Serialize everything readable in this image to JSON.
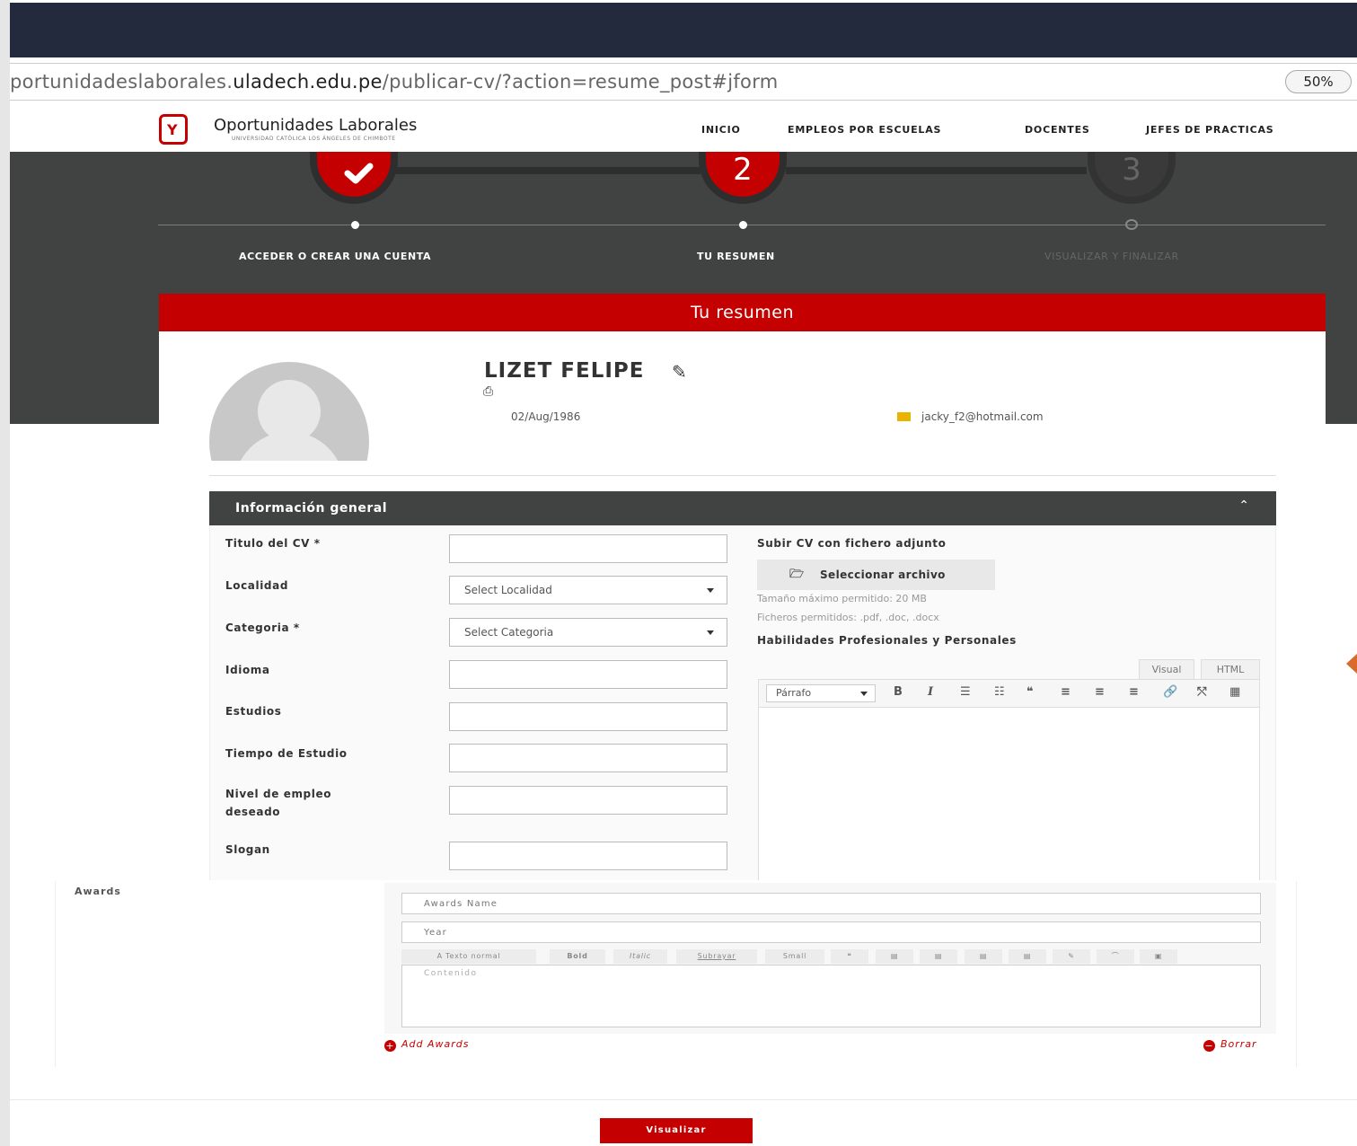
{
  "browser": {
    "url_prefix": "portunidadeslaborales.",
    "url_domain": "uladech.edu.pe",
    "url_path": "/publicar-cv/?action=resume_post#jform",
    "zoom": "50%"
  },
  "nav": {
    "logo_title": "Oportunidades Laborales",
    "logo_sub": "UNIVERSIDAD CATÓLICA LOS ÁNGELES DE CHIMBOTE",
    "items": [
      "INICIO",
      "EMPLEOS POR ESCUELAS",
      "DOCENTES",
      "JEFES DE PRACTICAS"
    ]
  },
  "steps": [
    {
      "label": "ACCEDER O CREAR UNA CUENTA",
      "state": "done",
      "number": ""
    },
    {
      "label": "TU RESUMEN",
      "state": "active",
      "number": "2"
    },
    {
      "label": "VISUALIZAR Y FINALIZAR",
      "state": "pending",
      "number": "3"
    }
  ],
  "panel": {
    "title": "Tu resumen"
  },
  "profile": {
    "name": "LIZET FELIPE",
    "dob": "02/Aug/1986",
    "email": "jacky_f2@hotmail.com"
  },
  "section": {
    "title": "Información general",
    "toggle": "⌃"
  },
  "form": {
    "titulo_label": "Titulo del CV *",
    "localidad_label": "Localidad",
    "localidad_value": "Select Localidad",
    "categoria_label": "Categoria *",
    "categoria_value": "Select Categoria",
    "idioma_label": "Idioma",
    "estudios_label": "Estudios",
    "tiempo_label": "Tiempo de Estudio",
    "nivel_label_1": "Nivel de empleo",
    "nivel_label_2": "deseado",
    "slogan_label": "Slogan"
  },
  "upload": {
    "label": "Subir CV con fichero adjunto",
    "button": "Seleccionar archivo",
    "max_size": "Tamaño máximo permitido: 20 MB",
    "allowed": "Ficheros permitidos: .pdf, .doc, .docx"
  },
  "skills": {
    "label": "Habilidades Profesionales y Personales",
    "tab_visual": "Visual",
    "tab_html": "HTML",
    "format": "Párrafo"
  },
  "awards": {
    "label": "Awards",
    "name_placeholder": "Awards Name",
    "year_placeholder": "Year",
    "content_placeholder": "Contenido",
    "toolbar": [
      "A  Texto normal",
      "Bold",
      "Italic",
      "Subrayar",
      "Small",
      "❝",
      "▤",
      "▤",
      "▤",
      "▤",
      "✎",
      "⌒",
      "▣"
    ],
    "add": "Add Awards",
    "delete": "Borrar"
  },
  "submit": "Visualizar",
  "colors": {
    "brand_red": "#c40000",
    "dark": "#414242",
    "topbar": "#232a3d"
  }
}
